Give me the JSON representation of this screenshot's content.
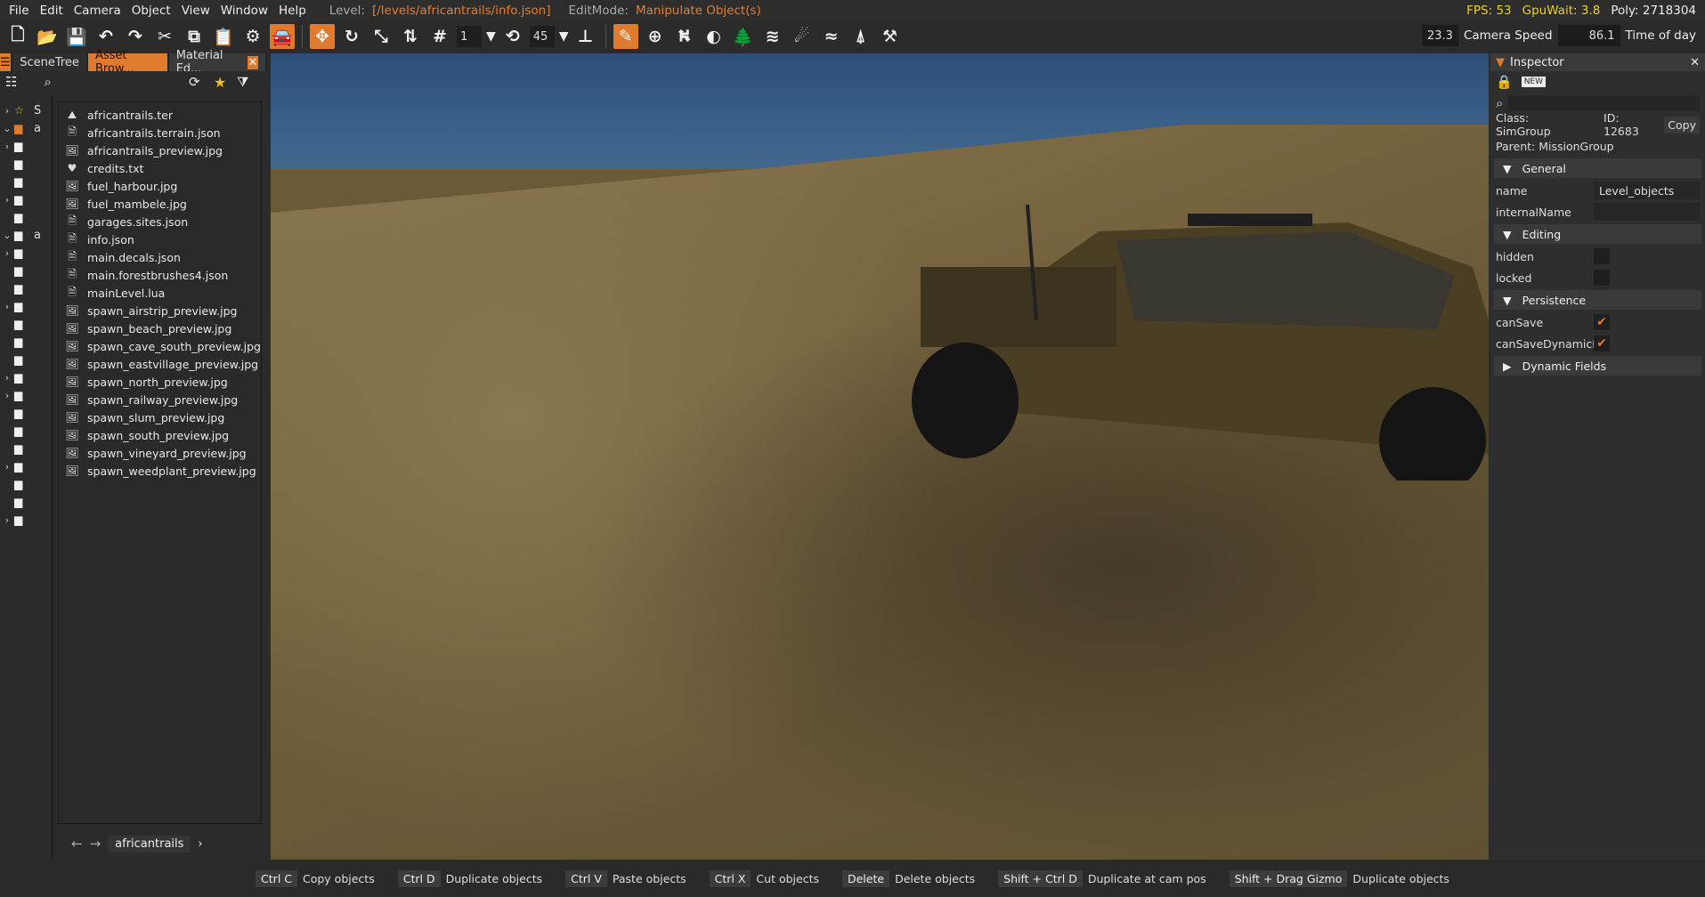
{
  "menu": [
    "File",
    "Edit",
    "Camera",
    "Object",
    "View",
    "Window",
    "Help"
  ],
  "level_label": "Level:",
  "level_path": "[/levels/africantrails/info.json]",
  "editmode_label": "EditMode:",
  "editmode_value": "Manipulate Object(s)",
  "stats": {
    "fps": "FPS: 53",
    "gpuwait": "GpuWait: 3.8",
    "poly": "Poly: 2718304"
  },
  "toolbar": {
    "snap_value": "1",
    "angle_value": "45"
  },
  "camera": {
    "fov": "23.3",
    "speed_label": "Camera Speed",
    "speed": "86.1",
    "tod_label": "Time of day"
  },
  "tabs": [
    {
      "label": "SceneTree"
    },
    {
      "label": "Asset Brow..."
    },
    {
      "label": "Material Ed..."
    }
  ],
  "tree": [
    {
      "arrow": "›",
      "label": "S"
    },
    {
      "arrow": "⌄",
      "label": "a"
    },
    {
      "arrow": "›",
      "label": ""
    },
    {
      "arrow": "",
      "label": ""
    },
    {
      "arrow": "",
      "label": ""
    },
    {
      "arrow": "›",
      "label": ""
    },
    {
      "arrow": "",
      "label": ""
    },
    {
      "arrow": "⌄",
      "label": "a"
    },
    {
      "arrow": "›",
      "label": ""
    },
    {
      "arrow": "",
      "label": ""
    },
    {
      "arrow": "",
      "label": ""
    },
    {
      "arrow": "›",
      "label": ""
    },
    {
      "arrow": "",
      "label": ""
    },
    {
      "arrow": "",
      "label": ""
    },
    {
      "arrow": "",
      "label": ""
    },
    {
      "arrow": "›",
      "label": ""
    },
    {
      "arrow": "›",
      "label": ""
    },
    {
      "arrow": "",
      "label": ""
    },
    {
      "arrow": "",
      "label": ""
    },
    {
      "arrow": "",
      "label": ""
    },
    {
      "arrow": "›",
      "label": ""
    },
    {
      "arrow": "",
      "label": ""
    },
    {
      "arrow": "",
      "label": ""
    },
    {
      "arrow": "›",
      "label": ""
    }
  ],
  "files": [
    {
      "name": "africantrails.ter",
      "icon": "terrain-icon"
    },
    {
      "name": "africantrails.terrain.json",
      "icon": "file-icon"
    },
    {
      "name": "africantrails_preview.jpg",
      "icon": "image-icon"
    },
    {
      "name": "credits.txt",
      "icon": "heart-icon"
    },
    {
      "name": "fuel_harbour.jpg",
      "icon": "image-icon"
    },
    {
      "name": "fuel_mambele.jpg",
      "icon": "image-icon"
    },
    {
      "name": "garages.sites.json",
      "icon": "file-icon"
    },
    {
      "name": "info.json",
      "icon": "file-icon"
    },
    {
      "name": "main.decals.json",
      "icon": "file-icon"
    },
    {
      "name": "main.forestbrushes4.json",
      "icon": "file-icon"
    },
    {
      "name": "mainLevel.lua",
      "icon": "file-icon"
    },
    {
      "name": "spawn_airstrip_preview.jpg",
      "icon": "image-icon"
    },
    {
      "name": "spawn_beach_preview.jpg",
      "icon": "image-icon"
    },
    {
      "name": "spawn_cave_south_preview.jpg",
      "icon": "image-icon"
    },
    {
      "name": "spawn_eastvillage_preview.jpg",
      "icon": "image-icon"
    },
    {
      "name": "spawn_north_preview.jpg",
      "icon": "image-icon"
    },
    {
      "name": "spawn_railway_preview.jpg",
      "icon": "image-icon"
    },
    {
      "name": "spawn_slum_preview.jpg",
      "icon": "image-icon"
    },
    {
      "name": "spawn_south_preview.jpg",
      "icon": "image-icon"
    },
    {
      "name": "spawn_vineyard_preview.jpg",
      "icon": "image-icon"
    },
    {
      "name": "spawn_weedplant_preview.jpg",
      "icon": "image-icon"
    }
  ],
  "breadcrumb": "africantrails",
  "inspector": {
    "title": "Inspector",
    "class": "Class: SimGroup",
    "id": "ID: 12683",
    "copy": "Copy",
    "parent": "Parent: MissionGroup",
    "sections": {
      "general": "General",
      "editing": "Editing",
      "persistence": "Persistence",
      "dynamic": "Dynamic Fields"
    },
    "props": {
      "name_k": "name",
      "name_v": "Level_objects",
      "internal_k": "internalName",
      "internal_v": "",
      "hidden_k": "hidden",
      "locked_k": "locked",
      "cansave_k": "canSave",
      "cansavedyn_k": "canSaveDynamicFi"
    }
  },
  "shortcuts": [
    {
      "key": "Ctrl C",
      "desc": "Copy objects"
    },
    {
      "key": "Ctrl D",
      "desc": "Duplicate objects"
    },
    {
      "key": "Ctrl V",
      "desc": "Paste objects"
    },
    {
      "key": "Ctrl X",
      "desc": "Cut objects"
    },
    {
      "key": "Delete",
      "desc": "Delete objects"
    },
    {
      "key": "Shift + Ctrl D",
      "desc": "Duplicate at cam pos"
    },
    {
      "key": "Shift + Drag Gizmo",
      "desc": "Duplicate objects"
    }
  ],
  "colors": {
    "accent": "#e07a2e",
    "fps": "#f0d020"
  }
}
